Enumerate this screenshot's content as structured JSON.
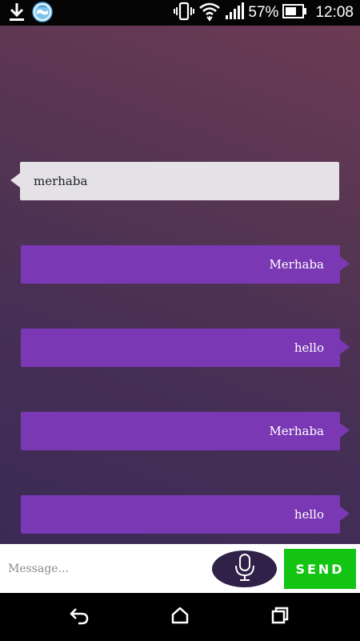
{
  "status_bar": {
    "battery": "57%",
    "time": "12:08",
    "icons": [
      "download-icon",
      "app-globe-icon",
      "vibrate-icon",
      "wifi-icon",
      "signal-icon",
      "battery-icon"
    ]
  },
  "messages": [
    {
      "text": "merhaba",
      "direction": "incoming"
    },
    {
      "text": "Merhaba",
      "direction": "outgoing"
    },
    {
      "text": "hello",
      "direction": "outgoing"
    },
    {
      "text": "Merhaba",
      "direction": "outgoing"
    },
    {
      "text": "hello",
      "direction": "outgoing"
    }
  ],
  "composer": {
    "placeholder": "Message...",
    "value": "",
    "send_label": "SEND",
    "mic_icon": "microphone-icon"
  },
  "nav": {
    "icons": [
      "back-icon",
      "home-icon",
      "recents-icon"
    ]
  },
  "colors": {
    "incoming_bubble": "#e4e2e6",
    "outgoing_bubble": "#7b38b4",
    "send_button": "#13c413",
    "mic_button": "#2f2148"
  }
}
